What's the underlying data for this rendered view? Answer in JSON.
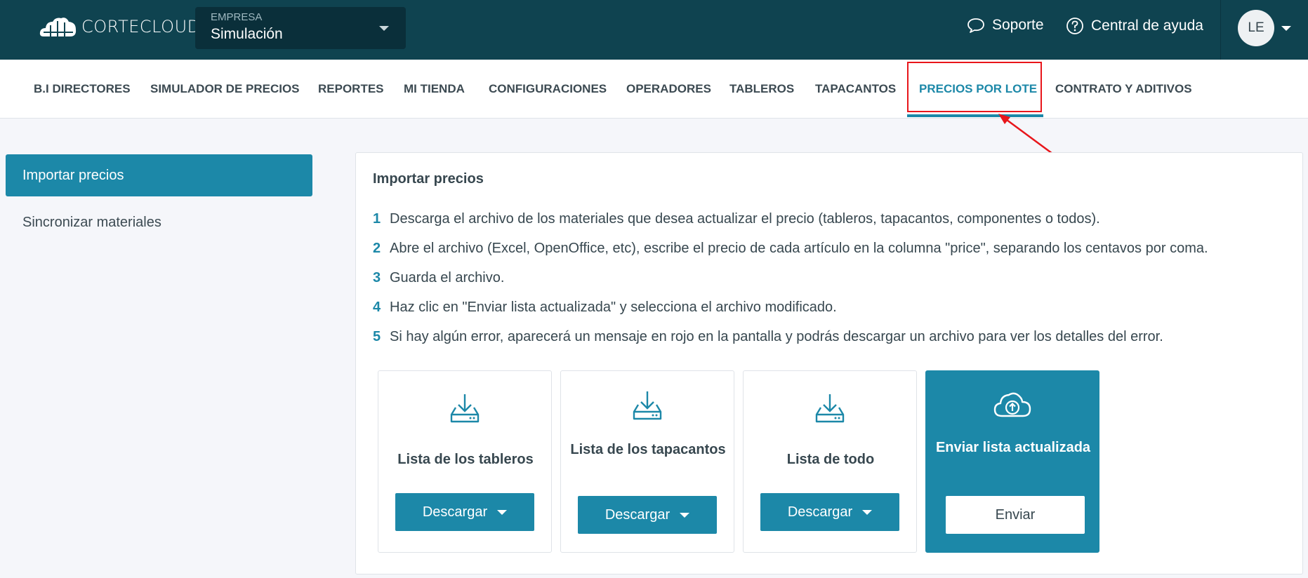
{
  "brand": {
    "name": "CORTECLOUD"
  },
  "company": {
    "label": "EMPRESA",
    "value": "Simulación"
  },
  "top_links": {
    "support": "Soporte",
    "help": "Central de ayuda"
  },
  "user": {
    "initials": "LE"
  },
  "nav": {
    "items": [
      {
        "label": "B.I DIRECTORES"
      },
      {
        "label": "SIMULADOR DE PRECIOS"
      },
      {
        "label": "REPORTES"
      },
      {
        "label": "MI TIENDA"
      },
      {
        "label": "CONFIGURACIONES"
      },
      {
        "label": "OPERADORES"
      },
      {
        "label": "TABLEROS"
      },
      {
        "label": "TAPACANTOS"
      },
      {
        "label": "PRECIOS POR LOTE",
        "active": true
      },
      {
        "label": "CONTRATO Y ADITIVOS"
      }
    ]
  },
  "sidebar": {
    "items": [
      {
        "label": "Importar precios",
        "active": true
      },
      {
        "label": "Sincronizar materiales"
      }
    ]
  },
  "main": {
    "title": "Importar precios",
    "steps": [
      {
        "num": "1",
        "text": "Descarga el archivo de los materiales que desea actualizar el precio (tableros, tapacantos, componentes o todos)."
      },
      {
        "num": "2",
        "text": "Abre el archivo (Excel, OpenOffice, etc), escribe el precio de cada artículo en la columna \"price\", separando los centavos por coma."
      },
      {
        "num": "3",
        "text": "Guarda el archivo."
      },
      {
        "num": "4",
        "text": "Haz clic en \"Enviar lista actualizada\" y selecciona el archivo modificado."
      },
      {
        "num": "5",
        "text": "Si hay algún error, aparecerá un mensaje en rojo en la pantalla y podrás descargar un archivo para ver los detalles del error."
      }
    ],
    "cards": [
      {
        "title": "Lista de los tableros",
        "button": "Descargar",
        "icon": "download-icon"
      },
      {
        "title": "Lista de los tapacantos",
        "button": "Descargar",
        "icon": "download-icon"
      },
      {
        "title": "Lista de todo",
        "button": "Descargar",
        "icon": "download-icon"
      },
      {
        "title": "Enviar lista actualizada",
        "button": "Enviar",
        "icon": "cloud-upload-icon"
      }
    ]
  },
  "colors": {
    "topbar": "#0f4350",
    "accent": "#1c88a8",
    "highlight": "#e8161b"
  }
}
